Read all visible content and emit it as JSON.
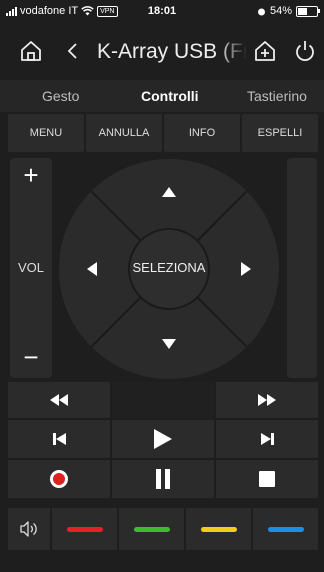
{
  "status": {
    "carrier": "vodafone IT",
    "vpn": "VPN",
    "time": "18:01",
    "battery": "54%",
    "battery_level": 0.54
  },
  "header": {
    "title": "K-Array USB (Fro",
    "home_icon": "home-icon",
    "back_icon": "chevron-left-icon",
    "add_icon": "add-device-icon",
    "power_icon": "power-icon"
  },
  "tabs": [
    {
      "label": "Gesto"
    },
    {
      "label": "Controlli",
      "active": true
    },
    {
      "label": "Tastierino"
    }
  ],
  "menu": [
    {
      "label": "MENU"
    },
    {
      "label": "ANNULLA"
    },
    {
      "label": "INFO"
    },
    {
      "label": "ESPELLI"
    }
  ],
  "volume": {
    "plus": "+",
    "label": "VOL",
    "minus": "−"
  },
  "dpad": {
    "select_label": "SELEZIONA"
  },
  "transport": {
    "rewind_icon": "rewind-icon",
    "fast_forward_icon": "fast-forward-icon",
    "previous_icon": "skip-previous-icon",
    "play_icon": "play-icon",
    "next_icon": "skip-next-icon",
    "record_icon": "record-icon",
    "pause_icon": "pause-icon",
    "stop_icon": "stop-icon"
  },
  "colors": {
    "background": "#1e1e1e",
    "button": "#2b2b2b",
    "record": "#e02020",
    "red": "#e8202a",
    "green": "#3dbd2c",
    "yellow": "#f2cf16",
    "blue": "#1a8fe8"
  }
}
